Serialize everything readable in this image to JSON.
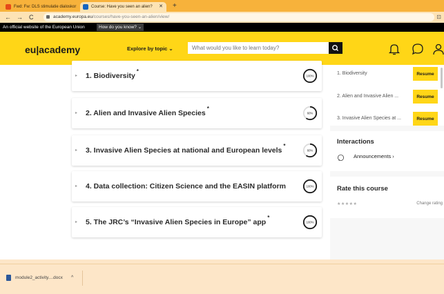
{
  "browser": {
    "tabs": [
      {
        "title": "Fwd: Fw: DLS stimulatie dialoskor"
      },
      {
        "title": "Course: Have you seen an alien?"
      }
    ],
    "url_host": "academy.europa.eu",
    "url_path": "/courses/have-you-seen-an-alien/view/"
  },
  "eu_banner": {
    "official": "An official website of the European Union",
    "how_know": "How do you know? ⌄"
  },
  "header": {
    "logo": "eu|academy",
    "explore": "Explore by topic ⌄",
    "search_placeholder": "What would you like to learn today?"
  },
  "modules": [
    {
      "title": "1. Biodiversity",
      "asterisk": "*",
      "progress_label": "100%",
      "progress": 1.0
    },
    {
      "title": "2. Alien and Invasive Alien Species",
      "asterisk": "*",
      "progress_label": "60%",
      "progress": 0.6
    },
    {
      "title": "3. Invasive Alien Species at national and European levels",
      "asterisk": "*",
      "progress_label": "60%",
      "progress": 0.6
    },
    {
      "title": "4. Data collection: Citizen Science and the EASIN platform",
      "asterisk": "",
      "progress_label": "100%",
      "progress": 1.0
    },
    {
      "title": "5. The JRC’s “Invasive Alien Species in Europe” app",
      "asterisk": "*",
      "progress_label": "100%",
      "progress": 1.0
    }
  ],
  "sidebar": {
    "resume_items": [
      {
        "label": "1. Biodiversity",
        "button": "Resume"
      },
      {
        "label": "2. Alien and Invasive Alien ...",
        "button": "Resume"
      },
      {
        "label": "3. Invasive Alien Species at ...",
        "button": "Resume"
      }
    ],
    "interactions_title": "Interactions",
    "announcements": "Announcements ›",
    "rate_title": "Rate this course",
    "stars": "★★★★★",
    "change_rating": "Change rating"
  },
  "download": {
    "filename": "module2_activity....docx",
    "chevron": "^"
  },
  "colors": {
    "brand_yellow": "#ffd617",
    "browser_orange": "#f7b23b",
    "dark": "#1b1b1b"
  }
}
